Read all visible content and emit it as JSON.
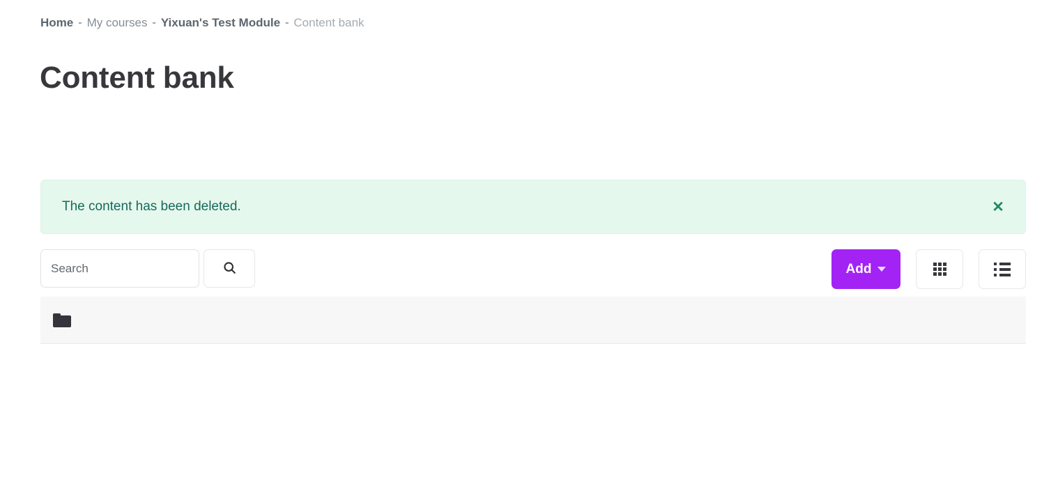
{
  "breadcrumb": {
    "separator": "-",
    "items": [
      {
        "label": "Home",
        "style": "strong"
      },
      {
        "label": "My courses",
        "style": "link"
      },
      {
        "label": "Yixuan's Test Module",
        "style": "strong"
      },
      {
        "label": "Content bank",
        "style": "current"
      }
    ]
  },
  "page": {
    "title": "Content bank"
  },
  "alert": {
    "message": "The content has been deleted.",
    "close_label": "✕",
    "background_color": "#e5f8ed",
    "text_color": "#17695a",
    "close_color": "#1f8a63"
  },
  "toolbar": {
    "search_placeholder": "Search",
    "search_value": "",
    "search_button_icon": "search-icon",
    "add_label": "Add",
    "add_caret_icon": "chevron-down-icon",
    "add_color": "#a323f5",
    "grid_view_icon": "grid-view-icon",
    "list_view_icon": "list-view-icon"
  },
  "content": {
    "rows": [
      {
        "icon": "folder-icon",
        "label": ""
      }
    ]
  }
}
